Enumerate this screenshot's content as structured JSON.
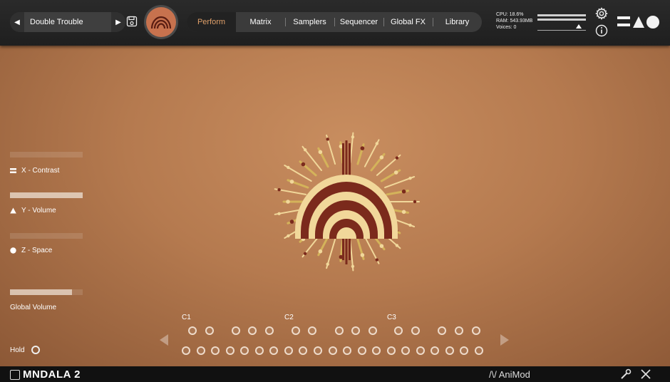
{
  "header": {
    "preset_name": "Double Trouble",
    "prev_arrow": "◀",
    "next_arrow": "▶",
    "tabs": [
      {
        "label": "Perform",
        "active": true
      },
      {
        "label": "Matrix"
      },
      {
        "label": "Samplers"
      },
      {
        "label": "Sequencer"
      },
      {
        "label": "Global FX"
      },
      {
        "label": "Library"
      }
    ],
    "stats": {
      "cpu": "CPU: 18.6%",
      "ram": "RAM: 543.93MB",
      "voices": "Voices: 0"
    }
  },
  "perform": {
    "xyz": [
      {
        "label": "X - Contrast",
        "marker": "lines-icon",
        "level": 0.0
      },
      {
        "label": "Y - Volume",
        "marker": "triangle-icon",
        "level": 1.0
      },
      {
        "label": "Z - Space",
        "marker": "circle-icon",
        "level": 0.0
      }
    ],
    "global_volume": {
      "label": "Global Volume",
      "level": 0.85
    },
    "hold_label": "Hold",
    "octaves": [
      "C1",
      "C2",
      "C3"
    ]
  },
  "footer": {
    "product": "MNDALA 2",
    "company": "AniMod"
  },
  "colors": {
    "accent": "#e0a06a",
    "logo_bg": "#c7724e",
    "mandala_dark": "#7b2a1c",
    "mandala_light": "#f1d79a",
    "mandala_gold": "#d4b35a"
  }
}
